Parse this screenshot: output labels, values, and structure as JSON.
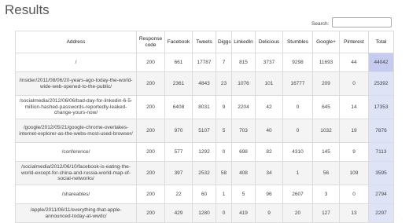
{
  "page": {
    "title": "Results"
  },
  "search": {
    "label": "Search:",
    "value": ""
  },
  "table": {
    "headers": [
      "Address",
      "Response code",
      "Facebook",
      "Tweets",
      "Diggs",
      "LinkedIn",
      "Delicious",
      "Stumbles",
      "Google+",
      "Pinterest",
      "Total"
    ],
    "rows": [
      {
        "address": "/",
        "response": "200",
        "facebook": "661",
        "tweets": "17787",
        "diggs": "7",
        "linkedin": "815",
        "delicious": "3737",
        "stumbles": "9298",
        "googleplus": "11693",
        "pinterest": "44",
        "total": "44042"
      },
      {
        "address": "/insider/2011/08/06/20-years-ago-today-the-world-wide-web-opened-to-the-public/",
        "response": "200",
        "facebook": "2361",
        "tweets": "4843",
        "diggs": "23",
        "linkedin": "1076",
        "delicious": "101",
        "stumbles": "16777",
        "googleplus": "209",
        "pinterest": "0",
        "total": "25392"
      },
      {
        "address": "/socialmedia/2012/06/06/bad-day-for-linkedin-6-5-million-hashed-passwords-reportedly-leaked-change-yours-now/",
        "response": "200",
        "facebook": "6408",
        "tweets": "8031",
        "diggs": "9",
        "linkedin": "2204",
        "delicious": "42",
        "stumbles": "0",
        "googleplus": "645",
        "pinterest": "14",
        "total": "17353"
      },
      {
        "address": "/google/2012/05/21/google-chrome-overtakes-internet-explorer-as-the-webs-most-used-browser/",
        "response": "200",
        "facebook": "970",
        "tweets": "5107",
        "diggs": "5",
        "linkedin": "703",
        "delicious": "40",
        "stumbles": "0",
        "googleplus": "1032",
        "pinterest": "19",
        "total": "7876"
      },
      {
        "address": "/conference/",
        "response": "200",
        "facebook": "577",
        "tweets": "1292",
        "diggs": "0",
        "linkedin": "698",
        "delicious": "82",
        "stumbles": "4310",
        "googleplus": "145",
        "pinterest": "9",
        "total": "7113"
      },
      {
        "address": "/socialmedia/2012/06/10/facebook-is-eating-the-world-except-for-china-and-russia-world-map-of-social-networks/",
        "response": "200",
        "facebook": "397",
        "tweets": "2532",
        "diggs": "58",
        "linkedin": "408",
        "delicious": "34",
        "stumbles": "1",
        "googleplus": "56",
        "pinterest": "109",
        "total": "3595"
      },
      {
        "address": "/shareables/",
        "response": "200",
        "facebook": "22",
        "tweets": "60",
        "diggs": "1",
        "linkedin": "5",
        "delicious": "96",
        "stumbles": "2607",
        "googleplus": "3",
        "pinterest": "0",
        "total": "2794"
      },
      {
        "address": "/apple/2011/06/11/everything-that-apple-announced-today-at-wwdc/",
        "response": "200",
        "facebook": "429",
        "tweets": "1280",
        "diggs": "0",
        "linkedin": "419",
        "delicious": "9",
        "stumbles": "20",
        "googleplus": "127",
        "pinterest": "13",
        "total": "2297"
      }
    ]
  },
  "colors": {
    "total_highlight": "#c5ccef",
    "total_light": "#dfe3f6",
    "row_alt": "#f4f4f4"
  }
}
